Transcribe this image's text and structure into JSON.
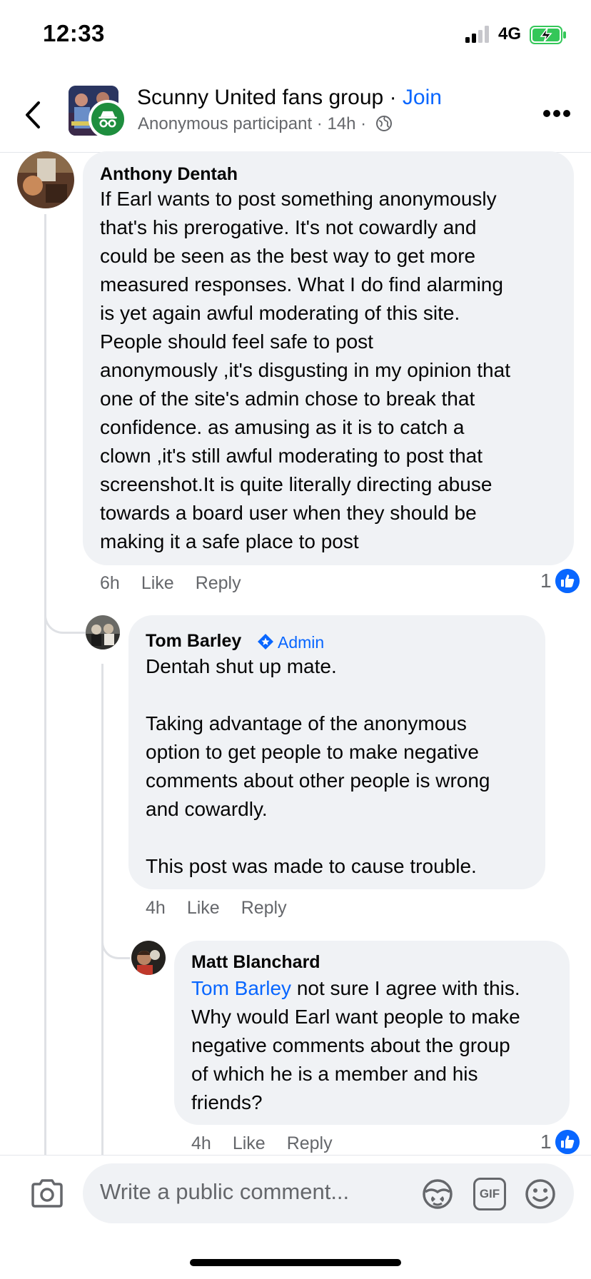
{
  "status_bar": {
    "time": "12:33",
    "network": "4G"
  },
  "header": {
    "group_name": "Scunny United fans group",
    "separator": " · ",
    "join_label": "Join",
    "meta": "Anonymous participant · 14h ·"
  },
  "comments": [
    {
      "author": "Anthony Dentah",
      "text": "If Earl wants to post something anonymously\nthat's his prerogative. It's not cowardly and\ncould be seen as the best way to get more\nmeasured responses. What I do find alarming\nis yet again awful moderating of this site.\nPeople should feel safe to post\nanonymously ,it's disgusting in my opinion that\none of the site's admin chose to break that\nconfidence. as amusing  as it is to catch a\nclown ,it's still awful moderating to post  that\nscreenshot.It is quite literally directing abuse\ntowards a board user when they should be\nmaking it a safe place to post",
      "time": "6h",
      "like_label": "Like",
      "reply_label": "Reply",
      "reactions": "1"
    },
    {
      "author": "Tom Barley",
      "badge": "Admin",
      "text": "Dentah shut up mate.\n\nTaking advantage of the anonymous\noption to get people to make negative\ncomments about other people is wrong\nand cowardly.\n\nThis post was made to cause trouble.",
      "time": "4h",
      "like_label": "Like",
      "reply_label": "Reply"
    },
    {
      "author": "Matt Blanchard",
      "mention": "Tom Barley",
      "text_first": " not sure I agree with this.",
      "text": "Why would Earl want people to make\nnegative comments about the group\nof which he is a member and his\nfriends?",
      "time": "4h",
      "like_label": "Like",
      "reply_label": "Reply",
      "reactions": "1"
    }
  ],
  "composer": {
    "placeholder": "Write a public comment...",
    "gif_label": "GIF"
  },
  "icons": {
    "back": "chevron-left-icon",
    "more": "more-horizontal-icon",
    "camera": "camera-icon",
    "sticker": "sticker-icon",
    "gif": "gif-icon",
    "emoji": "emoji-icon",
    "globe": "globe-icon",
    "like": "thumbs-up-icon"
  },
  "colors": {
    "accent": "#0866ff",
    "secondary_text": "#65676b",
    "bubble": "#f0f2f5",
    "anon_badge": "#1e8e3e",
    "battery_charge": "#34c759"
  }
}
